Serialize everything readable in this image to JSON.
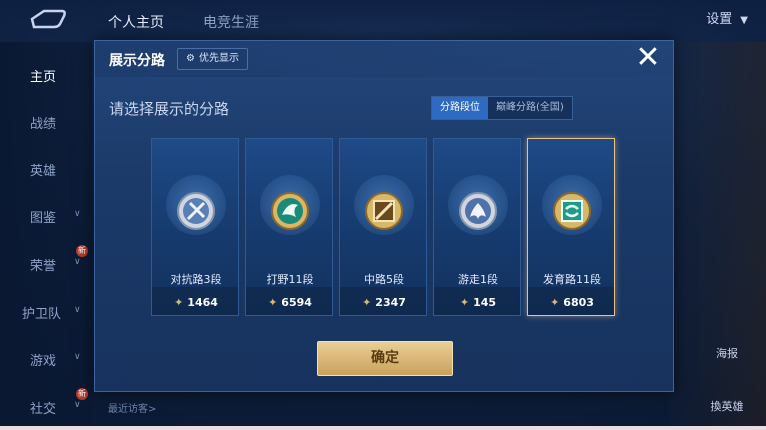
{
  "topbar": {
    "tabs": [
      "个人主页",
      "电竞生涯"
    ],
    "settings_label": "设置"
  },
  "sidebar": {
    "items": [
      {
        "label": "主页"
      },
      {
        "label": "战绩"
      },
      {
        "label": "英雄"
      },
      {
        "label": "图鉴"
      },
      {
        "label": "荣誉",
        "badge": "新"
      },
      {
        "label": "护卫队"
      },
      {
        "label": "游戏"
      },
      {
        "label": "社交",
        "badge": "新"
      }
    ],
    "visitor_label": "最近访客>"
  },
  "right_panel": {
    "labels": [
      "海报",
      "換英雄"
    ]
  },
  "modal": {
    "title": "展示分路",
    "priority_button": "优先显示",
    "subtitle": "请选择展示的分路",
    "segments": [
      {
        "label": "分路段位",
        "active": true
      },
      {
        "label": "巅峰分路(全国)",
        "active": false
      }
    ],
    "cards": [
      {
        "name": "对抗路3段",
        "score": "1464",
        "icon": "sword-icon",
        "selected": false
      },
      {
        "name": "打野11段",
        "score": "6594",
        "icon": "jungle-dragon-icon",
        "selected": false
      },
      {
        "name": "中路5段",
        "score": "2347",
        "icon": "mid-lane-icon",
        "selected": false
      },
      {
        "name": "游走1段",
        "score": "145",
        "icon": "roam-wings-icon",
        "selected": false
      },
      {
        "name": "发育路11段",
        "score": "6803",
        "icon": "farm-lane-icon",
        "selected": true
      }
    ],
    "confirm_label": "确定"
  },
  "colors": {
    "accent": "#2f6ac2",
    "gold": "#d9b97a",
    "selected_border": "#e7c38a"
  }
}
